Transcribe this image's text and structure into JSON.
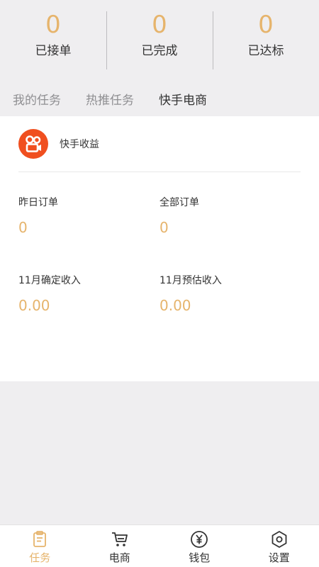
{
  "stats": [
    {
      "value": "0",
      "label": "已接单"
    },
    {
      "value": "0",
      "label": "已完成"
    },
    {
      "value": "0",
      "label": "已达标"
    }
  ],
  "tabs": [
    {
      "label": "我的任务",
      "active": false
    },
    {
      "label": "热推任务",
      "active": false
    },
    {
      "label": "快手电商",
      "active": true
    }
  ],
  "card": {
    "logo_icon": "kuaishou-camera-icon",
    "title": "快手收益",
    "metrics": [
      {
        "label": "昨日订单",
        "value": "0"
      },
      {
        "label": "全部订单",
        "value": "0"
      },
      {
        "label": "11月确定收入",
        "value": "0.00"
      },
      {
        "label": "11月预估收入",
        "value": "0.00"
      }
    ]
  },
  "tabbar": [
    {
      "label": "任务",
      "icon": "clipboard-icon",
      "active": true
    },
    {
      "label": "电商",
      "icon": "cart-icon",
      "active": false
    },
    {
      "label": "钱包",
      "icon": "yen-coin-icon",
      "active": false
    },
    {
      "label": "设置",
      "icon": "hexagon-settings-icon",
      "active": false
    }
  ],
  "colors": {
    "accent": "#e6b46c",
    "logo": "#f04f1f",
    "background": "#efeef0"
  }
}
